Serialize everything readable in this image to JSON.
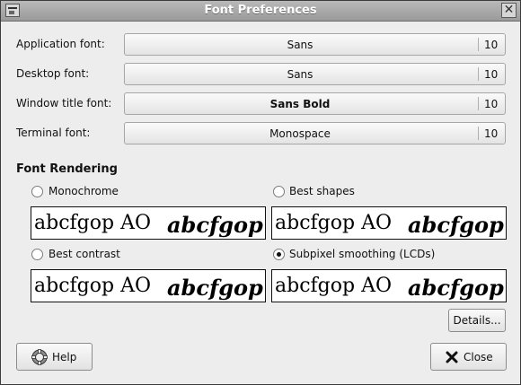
{
  "window": {
    "title": "Font Preferences"
  },
  "fonts": [
    {
      "label": "Application font:",
      "name": "Sans",
      "size": "10",
      "bold": false
    },
    {
      "label": "Desktop font:",
      "name": "Sans",
      "size": "10",
      "bold": false
    },
    {
      "label": "Window title font:",
      "name": "Sans Bold",
      "size": "10",
      "bold": true
    },
    {
      "label": "Terminal font:",
      "name": "Monospace",
      "size": "10",
      "bold": false
    }
  ],
  "rendering": {
    "heading": "Font Rendering",
    "options": [
      {
        "label": "Monochrome",
        "selected": false
      },
      {
        "label": "Best shapes",
        "selected": false
      },
      {
        "label": "Best contrast",
        "selected": false
      },
      {
        "label": "Subpixel smoothing (LCDs)",
        "selected": true
      }
    ],
    "preview_normal": "abcfgop AO",
    "preview_italic": "abcfgop"
  },
  "buttons": {
    "details": "Details...",
    "help": "Help",
    "close": "Close"
  }
}
